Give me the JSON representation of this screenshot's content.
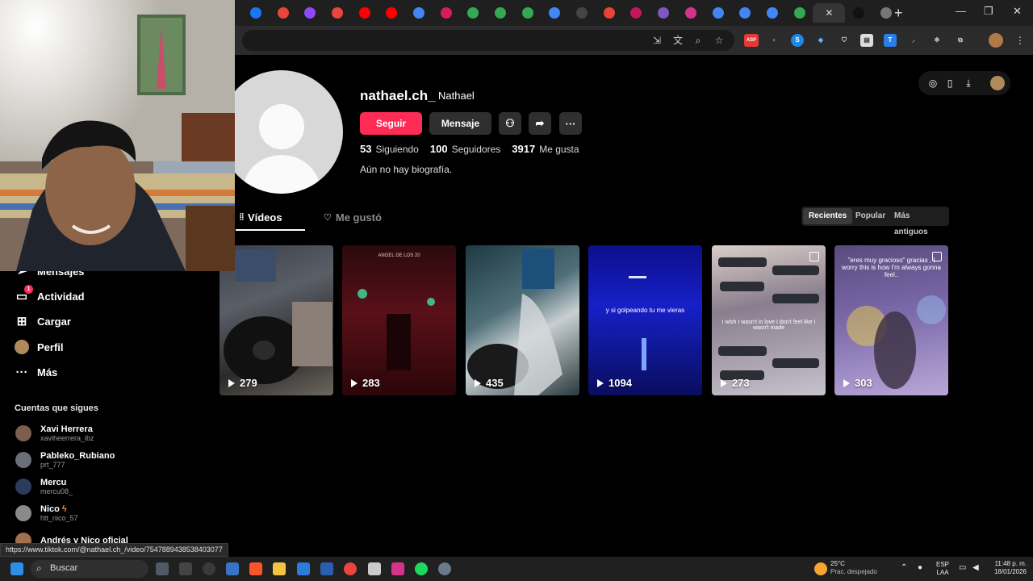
{
  "browser": {
    "tab_favicons": [
      "facebook-icon",
      "chrome-icon",
      "twitch-icon",
      "chrome-icon",
      "youtube-icon",
      "youtube-icon",
      "google-icon",
      "d-icon",
      "drive-icon",
      "drive-icon",
      "drive-icon",
      "google-icon",
      "github-icon",
      "gmail-icon",
      "screen-recorder-icon",
      "sss-icon",
      "instagram-icon",
      "google-icon",
      "google-icon",
      "google-icon",
      "maps-icon",
      "close-icon",
      "tiktok-icon",
      "globe-icon"
    ],
    "extension_badge": "ASP"
  },
  "sidebar": {
    "items": [
      {
        "label": "Mensajes",
        "icon": "messages-icon",
        "badge": ""
      },
      {
        "label": "Actividad",
        "icon": "activity-icon",
        "badge": "1"
      },
      {
        "label": "Cargar",
        "icon": "upload-icon",
        "badge": ""
      },
      {
        "label": "Perfil",
        "icon": "profile-icon",
        "badge": ""
      },
      {
        "label": "Más",
        "icon": "more-icon",
        "badge": ""
      }
    ],
    "following_title": "Cuentas que sigues",
    "following": [
      {
        "name": "Xavi Herrera",
        "handle": "xaviheerrera_ibz",
        "color": "#7a5f4e"
      },
      {
        "name": "Pableko_Rubiano",
        "handle": "prt_777",
        "color": "#6b6f76"
      },
      {
        "name": "Mercu",
        "handle": "mercu08_",
        "color": "#2c3a5c"
      },
      {
        "name": "Nico",
        "handle": "htt_nico_57",
        "color": "#8a8a8a"
      },
      {
        "name": "Andrés y Nico oficial",
        "handle": "",
        "color": "#a07050"
      }
    ]
  },
  "profile": {
    "username": "nathael.ch_",
    "display_name": "Nathael",
    "follow_label": "Seguir",
    "message_label": "Mensaje",
    "following_count": "53",
    "following_label": "Siguiendo",
    "followers_count": "100",
    "followers_label": "Seguidores",
    "likes_count": "3917",
    "likes_label": "Me gusta",
    "bio": "Aún no hay biografía."
  },
  "tabs": {
    "videos": "Vídeos",
    "liked": "Me gustó"
  },
  "sort": {
    "recent": "Recientes",
    "popular": "Popular",
    "oldest": "Más antiguos"
  },
  "videos": [
    {
      "views": "279",
      "caption": ""
    },
    {
      "views": "283",
      "caption": "ANGEL DE LOS 20"
    },
    {
      "views": "435",
      "caption": ""
    },
    {
      "views": "1094",
      "caption": "y si golpeando tu me vieras"
    },
    {
      "views": "273",
      "caption": "I wish I wasn't in love I don't feel like I wasn't made"
    },
    {
      "views": "303",
      "caption": "\"eres muy gracioso\" gracias , I worry this is how I'm always gonna feel.."
    }
  ],
  "status_url": "https://www.tiktok.com/@nathael.ch_/video/7547889438538403077",
  "taskbar": {
    "search_label": "Buscar",
    "weather_temp": "25°C",
    "weather_text": "Prac. despejado",
    "lang_top": "ESP",
    "lang_bottom": "LAA",
    "time": "11:48 p. m.",
    "date": "18/01/2026"
  }
}
